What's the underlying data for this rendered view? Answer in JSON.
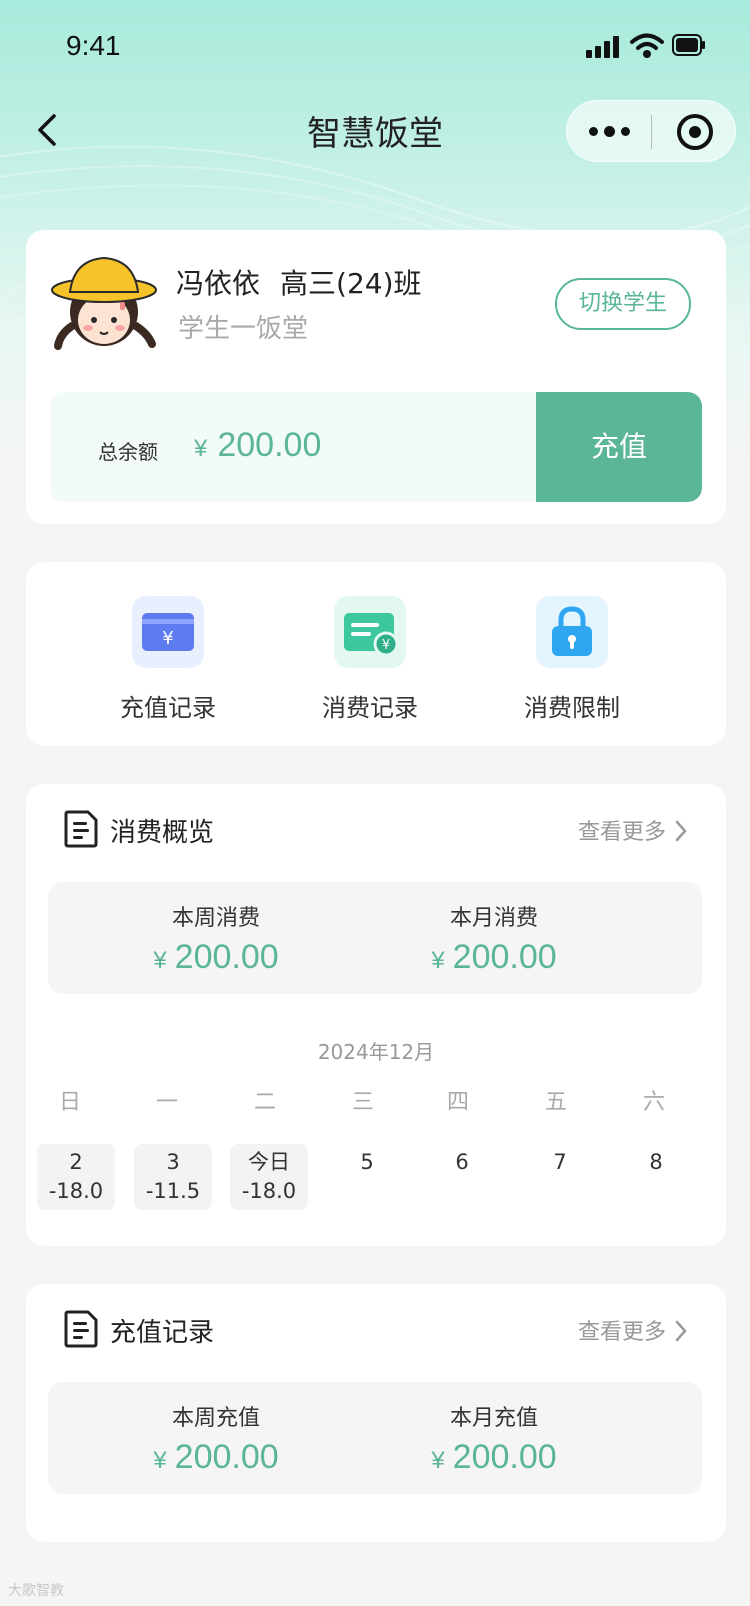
{
  "status_bar": {
    "time": "9:41"
  },
  "navbar": {
    "title": "智慧饭堂"
  },
  "student": {
    "name": "冯依依",
    "class": "高三(24)班",
    "canteen": "学生一饭堂",
    "switch_label": "切换学生"
  },
  "balance": {
    "label": "总余额",
    "currency": "¥",
    "amount": "200.00",
    "recharge_label": "充值"
  },
  "quick_actions": [
    {
      "label": "充值记录",
      "icon": "wallet-yen-icon"
    },
    {
      "label": "消费记录",
      "icon": "bill-yen-icon"
    },
    {
      "label": "消费限制",
      "icon": "lock-icon"
    }
  ],
  "consumption": {
    "title": "消费概览",
    "more": "查看更多",
    "week_label": "本周消费",
    "week_currency": "¥",
    "week_amount": "200.00",
    "month_label": "本月消费",
    "month_currency": "¥",
    "month_amount": "200.00",
    "calendar": {
      "month": "2024年12月",
      "weekdays": [
        "日",
        "一",
        "二",
        "三",
        "四",
        "五",
        "六"
      ],
      "days": [
        {
          "day": "2",
          "amount": "-18.0"
        },
        {
          "day": "3",
          "amount": "-11.5"
        },
        {
          "day": "今日",
          "amount": "-18.0"
        },
        {
          "day": "5",
          "amount": ""
        },
        {
          "day": "6",
          "amount": ""
        },
        {
          "day": "7",
          "amount": ""
        },
        {
          "day": "8",
          "amount": ""
        }
      ]
    }
  },
  "recharge_records": {
    "title": "充值记录",
    "more": "查看更多",
    "week_label": "本周充值",
    "week_currency": "¥",
    "week_amount": "200.00",
    "month_label": "本月充值",
    "month_currency": "¥",
    "month_amount": "200.00"
  },
  "watermark": "大歌智教",
  "colors": {
    "accent": "#5bb597",
    "header_bg": "#a7eadb",
    "page_bg": "#f5f5f5"
  }
}
